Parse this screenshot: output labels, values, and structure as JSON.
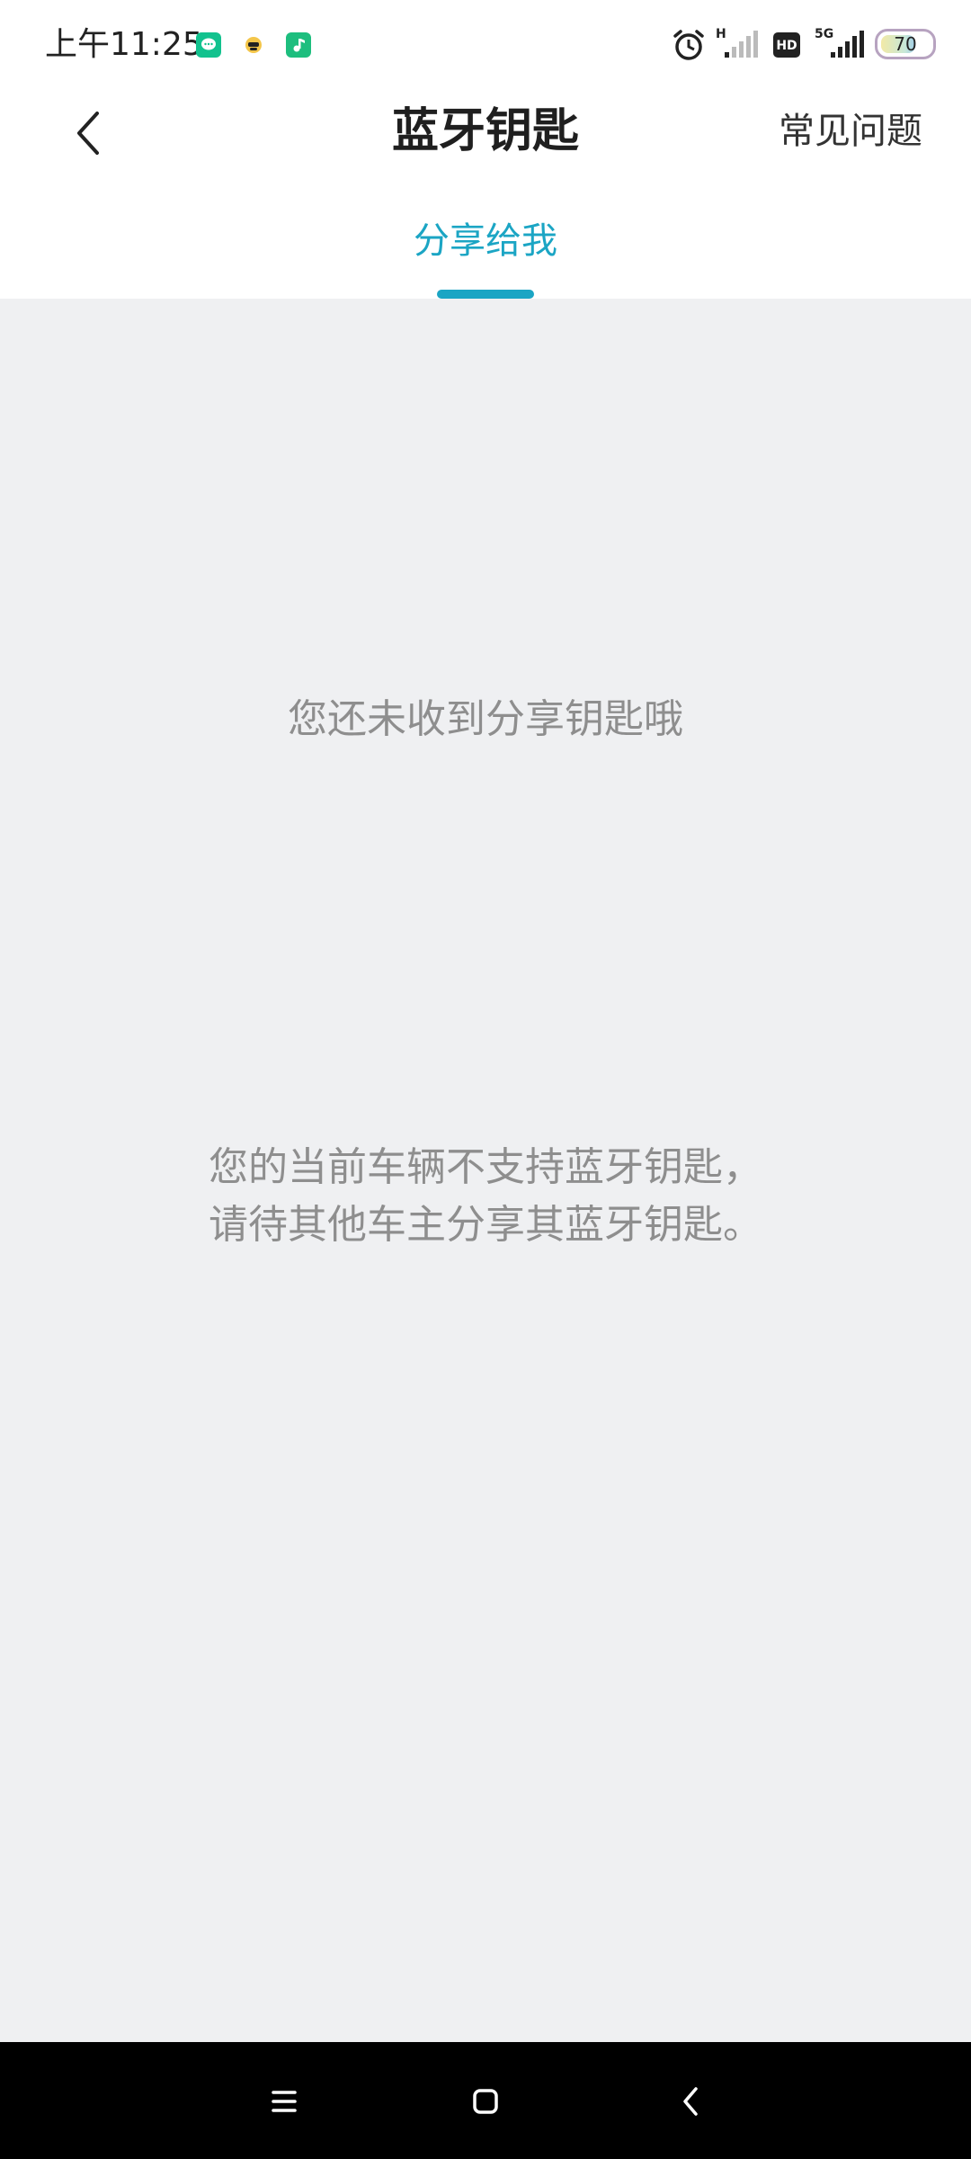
{
  "status_bar": {
    "time": "上午11:25",
    "network_1": "H",
    "hd_badge": "HD",
    "network_2": "5G",
    "battery_level": "70",
    "battery_fraction": 0.7,
    "notification_icons": [
      "message-app-icon",
      "mask-app-icon",
      "music-app-icon"
    ]
  },
  "header": {
    "title": "蓝牙钥匙",
    "faq_label": "常见问题"
  },
  "tabs": {
    "active_label": "分享给我"
  },
  "content": {
    "empty_message": "您还未收到分享钥匙哦",
    "support_note_line1": "您的当前车辆不支持蓝牙钥匙，",
    "support_note_line2": "请待其他车主分享其蓝牙钥匙。"
  },
  "colors": {
    "accent": "#1BA5C4",
    "background": "#EFF0F2"
  }
}
